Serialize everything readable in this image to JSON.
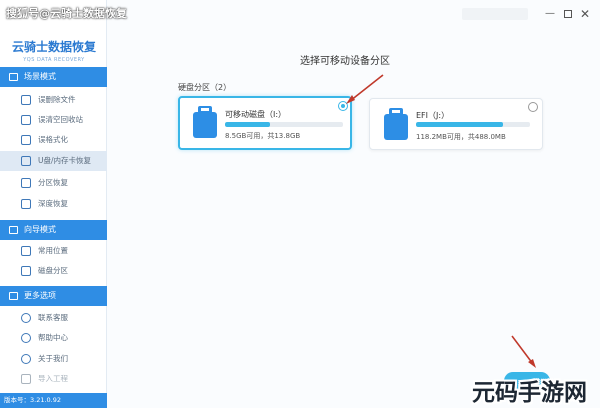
{
  "watermark": "搜狐号@云骑士数据恢复",
  "logo": {
    "title": "云骑士数据恢复",
    "subtitle": "YQS DATA RECOVERY"
  },
  "sidebar": {
    "sections": [
      {
        "title": "场景模式",
        "icon": "scene-mode-icon",
        "items": [
          {
            "label": "误删除文件",
            "icon": "file-icon"
          },
          {
            "label": "误清空回收站",
            "icon": "recycle-bin-icon"
          },
          {
            "label": "误格式化",
            "icon": "format-icon"
          },
          {
            "label": "U盘/内存卡恢复",
            "icon": "usb-drive-icon",
            "active": true
          },
          {
            "label": "分区恢复",
            "icon": "partition-icon"
          },
          {
            "label": "深度恢复",
            "icon": "deep-scan-icon"
          }
        ]
      },
      {
        "title": "向导模式",
        "icon": "wizard-mode-icon",
        "items": [
          {
            "label": "常用位置",
            "icon": "folder-icon"
          },
          {
            "label": "磁盘分区",
            "icon": "disk-icon"
          }
        ]
      },
      {
        "title": "更多选项",
        "icon": "more-options-icon",
        "items": [
          {
            "label": "联系客服",
            "icon": "headset-icon"
          },
          {
            "label": "帮助中心",
            "icon": "help-icon"
          },
          {
            "label": "关于我们",
            "icon": "info-icon"
          },
          {
            "label": "导入工程",
            "icon": "import-icon",
            "disabled": true
          }
        ]
      }
    ],
    "version": "版本号：3.21.0.92"
  },
  "main": {
    "heading": "选择可移动设备分区",
    "section_label": "硬盘分区（2）",
    "drives": [
      {
        "name": "可移动磁盘（I:）",
        "size": "8.5GB可用，共13.8GB",
        "used_fraction": 0.38,
        "selected": true,
        "icon": "usb-drive-icon"
      },
      {
        "name": "EFI（J:）",
        "size": "118.2MB可用，共488.0MB",
        "used_fraction": 0.76,
        "selected": false,
        "icon": "usb-drive-icon"
      }
    ]
  },
  "corner_logo": "元码手游网",
  "colors": {
    "accent": "#39b6e7",
    "sidebar_header": "#2f8de4",
    "icon_blue": "#2d8ee5",
    "annotation_arrow": "#c0392b"
  }
}
